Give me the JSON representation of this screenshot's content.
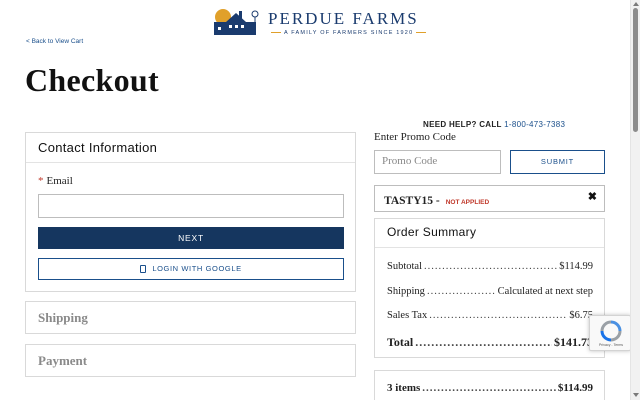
{
  "brand": {
    "name": "PERDUE FARMS",
    "tagline": "A FAMILY OF FARMERS SINCE 1920",
    "colors": {
      "navy": "#1a3b6e",
      "sun": "#e0a02a"
    }
  },
  "nav": {
    "back_label": "< Back to View Cart"
  },
  "page": {
    "title": "Checkout"
  },
  "contact": {
    "heading": "Contact Information",
    "email_required_mark": "*",
    "email_label": "Email",
    "email_value": "",
    "next_label": "NEXT",
    "google_icon": "google-icon",
    "google_label": "LOGIN WITH GOOGLE"
  },
  "sections": {
    "shipping": "Shipping",
    "payment": "Payment"
  },
  "help": {
    "label": "NEED HELP? CALL",
    "phone": "1-800-473-7383"
  },
  "promo": {
    "label": "Enter Promo Code",
    "placeholder": "Promo Code",
    "submit_label": "SUBMIT",
    "applied_code": "TASTY15 -",
    "applied_status": "NOT APPLIED",
    "remove_icon": "close-icon"
  },
  "summary": {
    "heading": "Order Summary",
    "rows": [
      {
        "label": "Subtotal",
        "value": "$114.99"
      },
      {
        "label": "Shipping",
        "value": "Calculated at next step"
      },
      {
        "label": "Sales Tax",
        "value": "$6.75"
      },
      {
        "label": "Total",
        "value": "$141.73"
      }
    ],
    "items": {
      "label": "3 items",
      "value": "$114.99"
    }
  },
  "recaptcha": {
    "text": "Privacy - Terms"
  },
  "colors": {
    "primary_button": "#15365f",
    "link": "#1a4f8b",
    "error": "#c0392b"
  }
}
